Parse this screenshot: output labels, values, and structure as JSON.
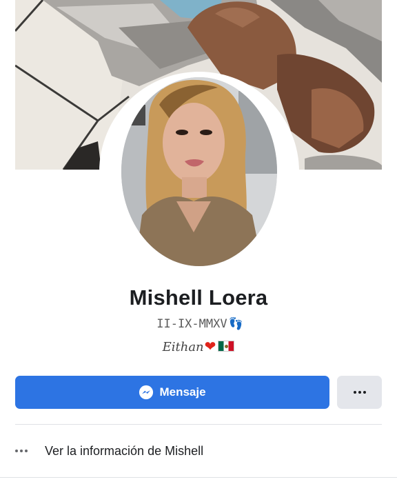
{
  "profile": {
    "name": "Mishell Loera",
    "bio_line_1": "II-IX-MMXV",
    "bio_line_1_emoji": "footprints",
    "bio_line_2": "Eithan",
    "bio_line_2_emoji": [
      "red-heart",
      "mexico-flag"
    ]
  },
  "actions": {
    "message_label": "Mensaje",
    "message_icon": "messenger-icon",
    "more_icon": "more-horizontal-icon"
  },
  "info": {
    "see_info_label": "Ver la información de Mishell",
    "icon": "more-horizontal-icon"
  },
  "colors": {
    "primary_button": "#2d74e3",
    "secondary_button": "#e4e6eb",
    "text": "#1c1e21"
  }
}
